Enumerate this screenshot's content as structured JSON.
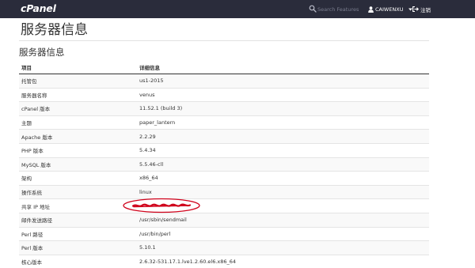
{
  "header": {
    "logo_text": "cPanel",
    "search_placeholder": "Search Features",
    "username": "CAIWENXU",
    "logout_label": "注销",
    "background_color": "#2a2c3b"
  },
  "page": {
    "title": "服务器信息",
    "section_title": "服务器信息"
  },
  "table": {
    "headers": [
      "项目",
      "详细信息"
    ],
    "rows": [
      {
        "item": "托管包",
        "detail": "us1-2015"
      },
      {
        "item": "服务器名称",
        "detail": "venus"
      },
      {
        "item": "cPanel 版本",
        "detail": "11.52.1 (build 3)"
      },
      {
        "item": "主题",
        "detail": "paper_lantern"
      },
      {
        "item": "Apache 版本",
        "detail": "2.2.29"
      },
      {
        "item": "PHP 版本",
        "detail": "5.4.34"
      },
      {
        "item": "MySQL 版本",
        "detail": "5.5.46-cll"
      },
      {
        "item": "架构",
        "detail": "x86_64"
      },
      {
        "item": "操作系统",
        "detail": "linux"
      },
      {
        "item": "共享 IP 地址",
        "detail": ""
      },
      {
        "item": "邮件发送路径",
        "detail": "/usr/sbin/sendmail"
      },
      {
        "item": "Perl 路径",
        "detail": "/usr/bin/perl"
      },
      {
        "item": "Perl 版本",
        "detail": "5.10.1"
      },
      {
        "item": "核心版本",
        "detail": "2.6.32-531.17.1.lve1.2.60.el6.x86_64"
      }
    ]
  },
  "annotation": {
    "redaction_color": "#d0021b"
  }
}
